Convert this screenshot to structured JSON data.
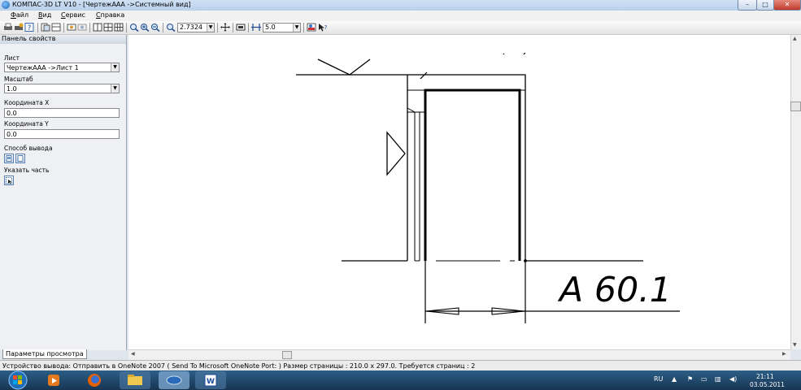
{
  "window": {
    "title": "КОМПАС-3D LT V10 - [ЧертежААА ->Системный вид]",
    "minimize_label": "–",
    "maximize_label": "□",
    "close_label": "✕"
  },
  "menu": [
    "Файл",
    "Вид",
    "Сервис",
    "Справка"
  ],
  "toolbar": {
    "zoom_value": "2.7324",
    "step_value": "5.0"
  },
  "panel": {
    "title": "Панель свойств",
    "sheet_label": "Лист",
    "sheet_value": "ЧертежААА ->Лист 1",
    "scale_label": "Масштаб",
    "scale_value": "1.0",
    "x_label": "Координата X",
    "x_value": "0.0",
    "y_label": "Координата Y",
    "y_value": "0.0",
    "output_label": "Способ вывода",
    "part_label": "Указать часть",
    "tab_label": "Параметры просмотра"
  },
  "drawing": {
    "dimension_text": "A 60.1"
  },
  "status": {
    "text": "Устройство вывода: Отправить в OneNote 2007 ( Send To Microsoft OneNote Port: )  Размер страницы : 210.0 x 297.0.  Требуется страниц : 2"
  },
  "taskbar": {
    "lang": "RU",
    "time": "21:11",
    "date": "03.05.2011"
  },
  "colors": {
    "titlebar": "#b9d1ec",
    "taskbar": "#1f456a",
    "canvas": "#ffffff"
  }
}
